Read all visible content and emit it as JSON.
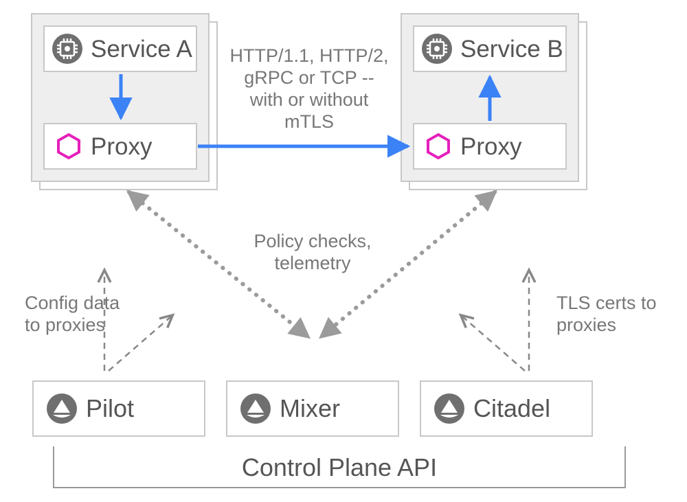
{
  "pods": {
    "a": {
      "service_label": "Service A",
      "proxy_label": "Proxy"
    },
    "b": {
      "service_label": "Service B",
      "proxy_label": "Proxy"
    }
  },
  "annotations": {
    "protocol_line1": "HTTP/1.1, HTTP/2,",
    "protocol_line2": "gRPC or TCP --",
    "protocol_line3": "with or without",
    "protocol_line4": "mTLS",
    "policy_line1": "Policy checks,",
    "policy_line2": "telemetry",
    "config_line1": "Config data",
    "config_line2": "to proxies",
    "tls_line1": "TLS certs to",
    "tls_line2": "proxies"
  },
  "control_plane": {
    "pilot_label": "Pilot",
    "mixer_label": "Mixer",
    "citadel_label": "Citadel",
    "api_label": "Control Plane API"
  },
  "colors": {
    "blue": "#3b82f6",
    "magenta": "#e61fbb",
    "gray_icon": "#6f6f6f",
    "gray_line": "#9b9b9b",
    "box_stroke": "#c8c8c8",
    "pod_bg": "#eeeeee"
  }
}
